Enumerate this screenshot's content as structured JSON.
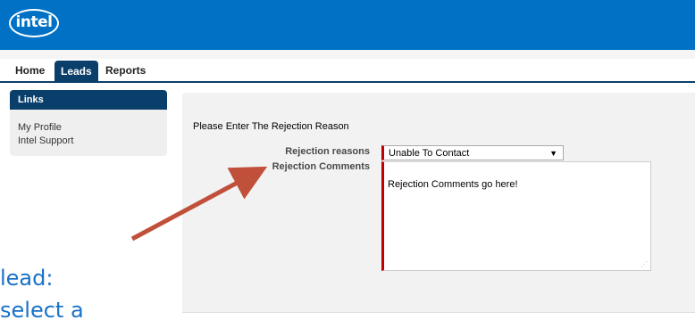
{
  "header": {
    "logo_text": "intel",
    "bg_color": "#0071c5"
  },
  "tabs": [
    {
      "label": "Home",
      "active": false
    },
    {
      "label": "Leads",
      "active": true
    },
    {
      "label": "Reports",
      "active": false
    }
  ],
  "sidebar": {
    "title": "Links",
    "links": [
      "My Profile",
      "Intel Support"
    ]
  },
  "form": {
    "prompt": "Please Enter The Rejection Reason",
    "reasons_label": "Rejection reasons",
    "reasons_value": "Unable To Contact",
    "comments_label": "Rejection Comments",
    "comments_value": "Rejection Comments go here!",
    "required_color": "#c00000"
  },
  "annotation": {
    "line1": "lead:",
    "line2": "select a",
    "text_color": "#1a72c7",
    "arrow_color": "#c0503a"
  }
}
